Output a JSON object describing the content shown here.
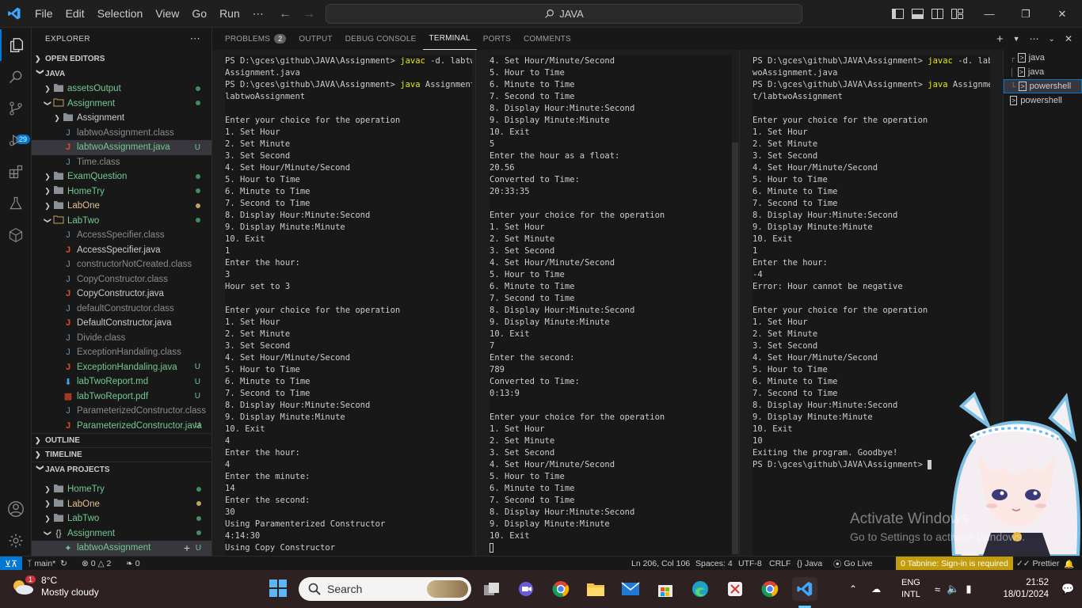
{
  "titlebar": {
    "menu": [
      "File",
      "Edit",
      "Selection",
      "View",
      "Go",
      "Run",
      "⋯"
    ],
    "search": "JAVA"
  },
  "sidebar": {
    "explorer_title": "EXPLORER",
    "open_editors": "OPEN EDITORS",
    "root": "JAVA",
    "tree": [
      {
        "label": "assetsOutput",
        "type": "folder",
        "depth": 1,
        "color": "#73c991",
        "status": "dot-green"
      },
      {
        "label": "Assignment",
        "type": "folder-open",
        "depth": 1,
        "color": "#73c991",
        "status": "dot-green"
      },
      {
        "label": "Assignment",
        "type": "folder",
        "depth": 2,
        "color": "#cccccc",
        "status": ""
      },
      {
        "label": "labtwoAssignment.class",
        "type": "class",
        "depth": 2,
        "color": "#8b8b8b",
        "status": ""
      },
      {
        "label": "labtwoAssignment.java",
        "type": "java",
        "depth": 2,
        "color": "#73c991",
        "status": "U",
        "selected": true
      },
      {
        "label": "Time.class",
        "type": "class",
        "depth": 2,
        "color": "#8b8b8b",
        "status": ""
      },
      {
        "label": "ExamQuestion",
        "type": "folder",
        "depth": 1,
        "color": "#73c991",
        "status": "dot-green"
      },
      {
        "label": "HomeTry",
        "type": "folder",
        "depth": 1,
        "color": "#73c991",
        "status": "dot-green"
      },
      {
        "label": "LabOne",
        "type": "folder",
        "depth": 1,
        "color": "#e2c08d",
        "status": "dot-yellow"
      },
      {
        "label": "LabTwo",
        "type": "folder-open",
        "depth": 1,
        "color": "#73c991",
        "status": "dot-green"
      },
      {
        "label": "AccessSpecifier.class",
        "type": "class",
        "depth": 2,
        "color": "#8b8b8b",
        "status": ""
      },
      {
        "label": "AccessSpecifier.java",
        "type": "java",
        "depth": 2,
        "color": "#cccccc",
        "status": ""
      },
      {
        "label": "constructorNotCreated.class",
        "type": "class",
        "depth": 2,
        "color": "#8b8b8b",
        "status": ""
      },
      {
        "label": "CopyConstructor.class",
        "type": "class",
        "depth": 2,
        "color": "#8b8b8b",
        "status": ""
      },
      {
        "label": "CopyConstructor.java",
        "type": "java",
        "depth": 2,
        "color": "#cccccc",
        "status": ""
      },
      {
        "label": "defaultConstructor.class",
        "type": "class",
        "depth": 2,
        "color": "#8b8b8b",
        "status": ""
      },
      {
        "label": "DefaultConstructor.java",
        "type": "java",
        "depth": 2,
        "color": "#cccccc",
        "status": ""
      },
      {
        "label": "Divide.class",
        "type": "class",
        "depth": 2,
        "color": "#8b8b8b",
        "status": ""
      },
      {
        "label": "ExceptionHandaling.class",
        "type": "class",
        "depth": 2,
        "color": "#8b8b8b",
        "status": ""
      },
      {
        "label": "ExceptionHandaling.java",
        "type": "java",
        "depth": 2,
        "color": "#73c991",
        "status": "U"
      },
      {
        "label": "labTwoReport.md",
        "type": "md",
        "depth": 2,
        "color": "#73c991",
        "status": "U"
      },
      {
        "label": "labTwoReport.pdf",
        "type": "pdf",
        "depth": 2,
        "color": "#73c991",
        "status": "U"
      },
      {
        "label": "ParameterizedConstructor.class",
        "type": "class",
        "depth": 2,
        "color": "#8b8b8b",
        "status": ""
      },
      {
        "label": "ParameterizedConstructor.java",
        "type": "java",
        "depth": 2,
        "color": "#73c991",
        "status": "U"
      }
    ],
    "outline": "OUTLINE",
    "timeline": "TIMELINE",
    "java_projects": "JAVA PROJECTS",
    "projects": [
      {
        "label": "HomeTry",
        "type": "folder",
        "depth": 1,
        "color": "#73c991",
        "status": "dot-green"
      },
      {
        "label": "LabOne",
        "type": "folder",
        "depth": 1,
        "color": "#e2c08d",
        "status": "dot-yellow"
      },
      {
        "label": "LabTwo",
        "type": "folder",
        "depth": 1,
        "color": "#73c991",
        "status": "dot-green"
      },
      {
        "label": "Assignment",
        "type": "pkg",
        "depth": 1,
        "color": "#73c991",
        "status": "dot-green",
        "open": true
      },
      {
        "label": "labtwoAssignment",
        "type": "cls",
        "depth": 2,
        "color": "#73c991",
        "status": "U",
        "selected": true
      }
    ]
  },
  "panel": {
    "tabs": [
      "PROBLEMS",
      "OUTPUT",
      "DEBUG CONSOLE",
      "TERMINAL",
      "PORTS",
      "COMMENTS"
    ],
    "problems_count": "2",
    "active_tab": "TERMINAL",
    "terminals": [
      "java",
      "java",
      "powershell",
      "powershell"
    ]
  },
  "term1": [
    "PS D:\\gces\\github\\JAVA\\Assignment> |javac| -d. labtwo",
    "Assignment.java",
    "PS D:\\gces\\github\\JAVA\\Assignment> |java| Assignment/",
    "labtwoAssignment",
    "",
    "Enter your choice for the operation",
    "1. Set Hour",
    "2. Set Minute",
    "3. Set Second",
    "4. Set Hour/Minute/Second",
    "5. Hour to Time",
    "6. Minute to Time",
    "7. Second to Time",
    "8. Display Hour:Minute:Second",
    "9. Display Minute:Minute",
    "10. Exit",
    "1",
    "Enter the hour:",
    "3",
    "Hour set to 3",
    "",
    "Enter your choice for the operation",
    "1. Set Hour",
    "2. Set Minute",
    "3. Set Second",
    "4. Set Hour/Minute/Second",
    "5. Hour to Time",
    "6. Minute to Time",
    "7. Second to Time",
    "8. Display Hour:Minute:Second",
    "9. Display Minute:Minute",
    "10. Exit",
    "4",
    "Enter the hour:",
    "4",
    "Enter the minute:",
    "14",
    "Enter the second:",
    "30",
    "Using Paramenterized Constructor",
    "4:14:30",
    "Using Copy Constructor"
  ],
  "term2": [
    "4. Set Hour/Minute/Second",
    "5. Hour to Time",
    "6. Minute to Time",
    "7. Second to Time",
    "8. Display Hour:Minute:Second",
    "9. Display Minute:Minute",
    "10. Exit",
    "5",
    "Enter the hour as a float:",
    "20.56",
    "Converted to Time:",
    "20:33:35",
    "",
    "Enter your choice for the operation",
    "1. Set Hour",
    "2. Set Minute",
    "3. Set Second",
    "4. Set Hour/Minute/Second",
    "5. Hour to Time",
    "6. Minute to Time",
    "7. Second to Time",
    "8. Display Hour:Minute:Second",
    "9. Display Minute:Minute",
    "10. Exit",
    "7",
    "Enter the second:",
    "789",
    "Converted to Time:",
    "0:13:9",
    "",
    "Enter your choice for the operation",
    "1. Set Hour",
    "2. Set Minute",
    "3. Set Second",
    "4. Set Hour/Minute/Second",
    "5. Hour to Time",
    "6. Minute to Time",
    "7. Second to Time",
    "8. Display Hour:Minute:Second",
    "9. Display Minute:Minute",
    "10. Exit"
  ],
  "term3": [
    "PS D:\\gces\\github\\JAVA\\Assignment> |javac| -d. labt",
    "woAssignment.java",
    "PS D:\\gces\\github\\JAVA\\Assignment> |java| Assignmen",
    "t/labtwoAssignment",
    "",
    "Enter your choice for the operation",
    "1. Set Hour",
    "2. Set Minute",
    "3. Set Second",
    "4. Set Hour/Minute/Second",
    "5. Hour to Time",
    "6. Minute to Time",
    "7. Second to Time",
    "8. Display Hour:Minute:Second",
    "9. Display Minute:Minute",
    "10. Exit",
    "1",
    "Enter the hour:",
    "-4",
    "Error: Hour cannot be negative",
    "",
    "Enter your choice for the operation",
    "1. Set Hour",
    "2. Set Minute",
    "3. Set Second",
    "4. Set Hour/Minute/Second",
    "5. Hour to Time",
    "6. Minute to Time",
    "7. Second to Time",
    "8. Display Hour:Minute:Second",
    "9. Display Minute:Minute",
    "10. Exit",
    "10",
    "Exiting the program. Goodbye!",
    "PS D:\\gces\\github\\JAVA\\Assignment> "
  ],
  "status": {
    "branch": "main*",
    "errors": "0",
    "warnings": "2",
    "ports": "0",
    "position": "Ln 206, Col 106",
    "spaces": "Spaces: 4",
    "encoding": "UTF-8",
    "eol": "CRLF",
    "language": "Java",
    "golive": "Go Live",
    "tabnine": "0 Tabnine: Sign-in is required",
    "prettier": "Prettier"
  },
  "watermark": {
    "title": "Activate Windows",
    "subtitle": "Go to Settings to activate Windows."
  },
  "taskbar": {
    "weather_badge": "1",
    "temperature": "8°C",
    "condition": "Mostly cloudy",
    "search_placeholder": "Search",
    "language": "ENG",
    "layout": "INTL",
    "time": "21:52",
    "date": "18/01/2024"
  },
  "colors": {
    "accent": "#0078d4",
    "git_untracked": "#73c991",
    "git_modified": "#e2c08d",
    "terminal_command": "#e5e510"
  }
}
